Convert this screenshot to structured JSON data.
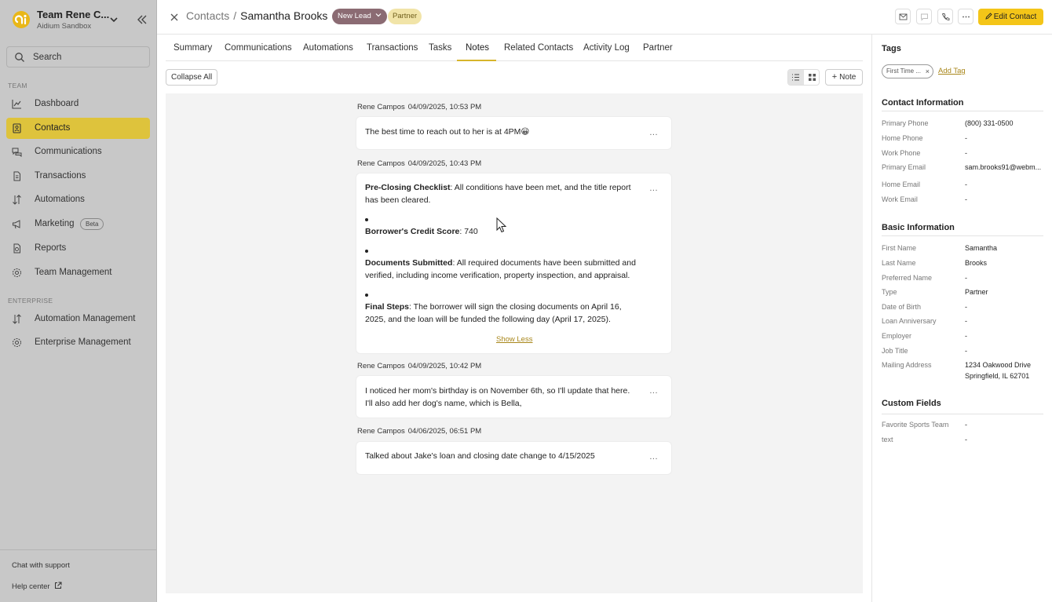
{
  "sidebar": {
    "team_name": "Team Rene C...",
    "org_name": "Aidium Sandbox",
    "search_placeholder": "Search",
    "team_section": "TEAM",
    "enterprise_section": "ENTERPRISE",
    "items": [
      {
        "label": "Dashboard",
        "icon": "chart-line-icon"
      },
      {
        "label": "Contacts",
        "icon": "contacts-icon",
        "active": true
      },
      {
        "label": "Communications",
        "icon": "chat-bubbles-icon"
      },
      {
        "label": "Transactions",
        "icon": "document-icon"
      },
      {
        "label": "Automations",
        "icon": "sort-arrows-icon"
      },
      {
        "label": "Marketing",
        "icon": "megaphone-icon",
        "badge": "Beta"
      },
      {
        "label": "Reports",
        "icon": "report-icon"
      },
      {
        "label": "Team Management",
        "icon": "gear-icon"
      }
    ],
    "enterprise_items": [
      {
        "label": "Automation Management",
        "icon": "sort-arrows-icon"
      },
      {
        "label": "Enterprise Management",
        "icon": "gear-icon"
      }
    ],
    "chat_support": "Chat with support",
    "help_center": "Help center"
  },
  "header": {
    "crumb_root": "Contacts",
    "crumb_sep": "/",
    "contact_name": "Samantha Brooks",
    "status_badge": "New Lead",
    "type_badge": "Partner",
    "edit_label": "Edit Contact"
  },
  "tabs": [
    "Summary",
    "Communications",
    "Automations",
    "Transactions",
    "Tasks",
    "Notes",
    "Related Contacts",
    "Activity Log",
    "Partner"
  ],
  "active_tab": "Notes",
  "toolbar": {
    "collapse_all": "Collapse All",
    "add_note": "Note"
  },
  "notes": [
    {
      "author": "Rene Campos",
      "date": "04/09/2025, 10:53 PM",
      "text": "The best time to reach out to her is at 4PM😀"
    },
    {
      "author": "Rene Campos",
      "date": "04/09/2025, 10:43 PM",
      "sections": [
        {
          "title": "Pre-Closing Checklist",
          "line1": ": All conditions have been met, and the title report",
          "line2": "has been cleared."
        },
        {
          "title": "Borrower's Credit Score",
          "line1": ": 740"
        },
        {
          "title": "Documents Submitted",
          "line1": ": All required documents have been submitted and",
          "line2": "verified, including income verification, property inspection, and appraisal."
        },
        {
          "title": "Final Steps",
          "line1": ": The borrower will sign the closing documents on April 16,",
          "line2": "2025, and the loan will be funded the following day (April 17, 2025)."
        }
      ],
      "show_less": "Show Less"
    },
    {
      "author": "Rene Campos",
      "date": "04/09/2025, 10:42 PM",
      "line1": "I noticed her mom's birthday is on November 6th, so I'll update that here.",
      "line2": "I'll also add her dog's name, which is Bella,"
    },
    {
      "author": "Rene Campos",
      "date": "04/06/2025, 06:51 PM",
      "text": "Talked about Jake's loan and closing date change to 4/15/2025"
    }
  ],
  "more_menu": "...",
  "right_panel": {
    "tags_title": "Tags",
    "tag": "First Time ...",
    "add_tag": "Add Tag",
    "contact_title": "Contact Information",
    "contact_fields": [
      {
        "label": "Primary Phone",
        "value": "(800) 331-0500"
      },
      {
        "label": "Home Phone",
        "value": "-"
      },
      {
        "label": "Work Phone",
        "value": "-"
      },
      {
        "label": "Primary Email",
        "value": "sam.brooks91@webm..."
      },
      {
        "label": "Home Email",
        "value": "-"
      },
      {
        "label": "Work Email",
        "value": "-"
      }
    ],
    "basic_title": "Basic Information",
    "basic_fields": [
      {
        "label": "First Name",
        "value": "Samantha"
      },
      {
        "label": "Last Name",
        "value": "Brooks"
      },
      {
        "label": "Preferred Name",
        "value": "-"
      },
      {
        "label": "Type",
        "value": "Partner"
      },
      {
        "label": "Date of Birth",
        "value": "-"
      },
      {
        "label": "Loan Anniversary",
        "value": "-"
      },
      {
        "label": "Employer",
        "value": "-"
      },
      {
        "label": "Job Title",
        "value": "-"
      }
    ],
    "address_label": "Mailing Address",
    "address_line1": "1234 Oakwood Drive",
    "address_line2": "Springfield, IL 62701",
    "custom_title": "Custom Fields",
    "custom_fields": [
      {
        "label": "Favorite Sports Team",
        "value": "-"
      },
      {
        "label": "text",
        "value": "-"
      }
    ]
  },
  "colors": {
    "accent": "#f4c518",
    "active_nav": "#dec33c",
    "lead_badge": "#8b6b73",
    "link": "#a8861a"
  }
}
